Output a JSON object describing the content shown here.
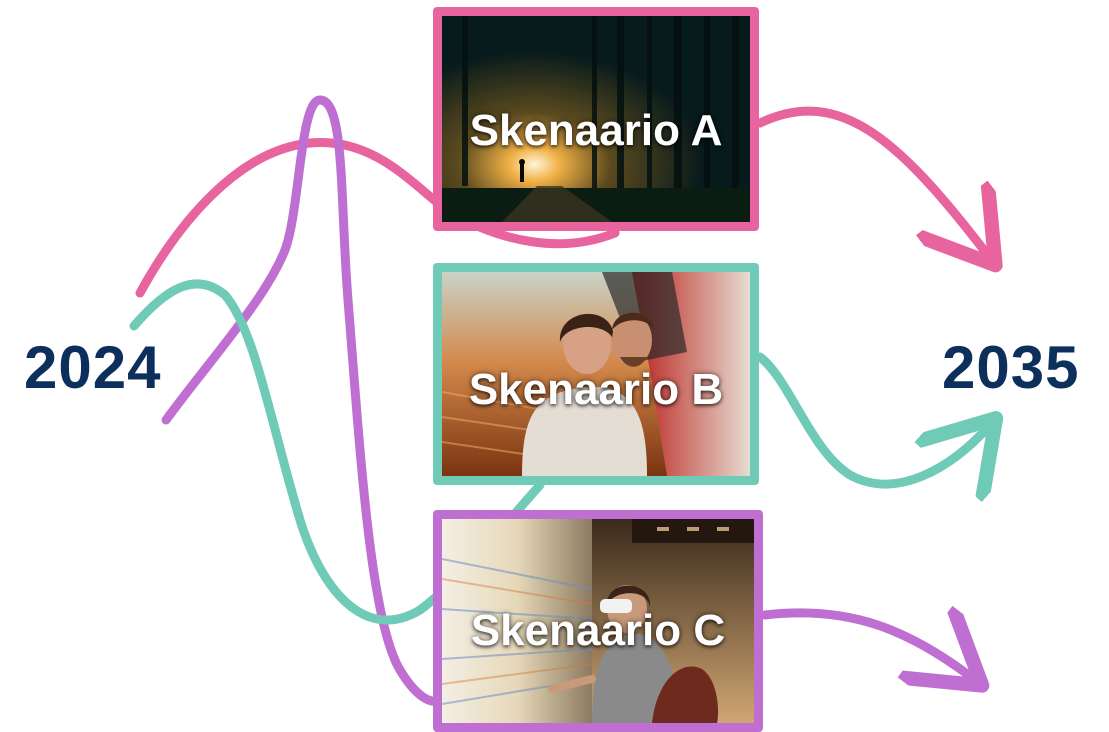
{
  "diagram": {
    "start_year": "2024",
    "end_year": "2035",
    "scenarios": [
      {
        "label": "Skenaario A",
        "color": "#e8649f"
      },
      {
        "label": "Skenaario B",
        "color": "#6fcab8"
      },
      {
        "label": "Skenaario C",
        "color": "#bf6fd1"
      }
    ],
    "year_color": "#0d2f5c"
  }
}
